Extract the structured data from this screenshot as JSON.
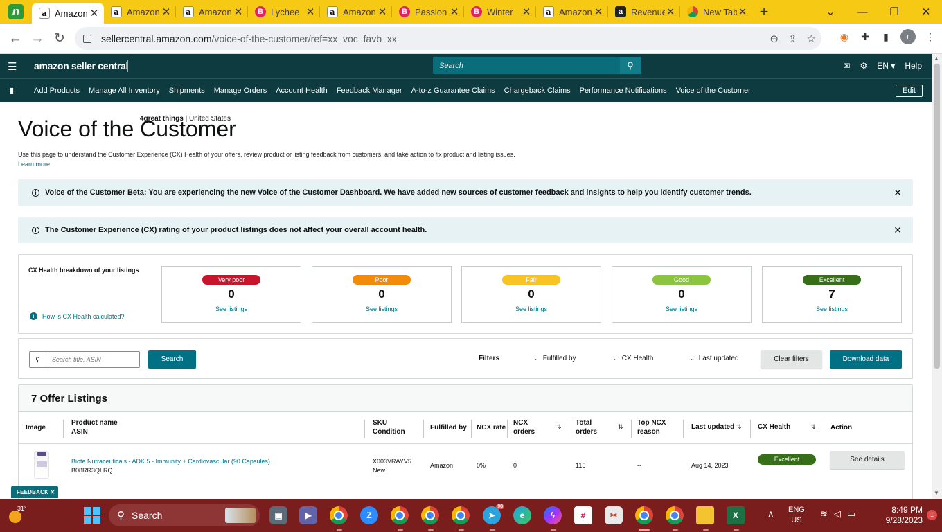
{
  "browser": {
    "tabs": [
      {
        "title": "Amazon",
        "favicon": "amazon-icon",
        "active": true
      },
      {
        "title": "Amazon",
        "favicon": "amazon-icon"
      },
      {
        "title": "Amazon",
        "favicon": "amazon-icon"
      },
      {
        "title": "Lychee",
        "favicon": "b-icon"
      },
      {
        "title": "Amazon",
        "favicon": "amazon-icon"
      },
      {
        "title": "Passion",
        "favicon": "b-icon"
      },
      {
        "title": "Winter",
        "favicon": "b-icon"
      },
      {
        "title": "Amazon",
        "favicon": "amazon-icon"
      },
      {
        "title": "Revenue",
        "favicon": "amazon-dark-icon"
      },
      {
        "title": "New Tab",
        "favicon": "chrome-icon"
      }
    ],
    "url_host": "sellercentral.amazon.com",
    "url_path": "/voice-of-the-customer/ref=xx_voc_favb_xx",
    "profile_initial": "r"
  },
  "header": {
    "brand": "amazon seller central",
    "store_name": "4great things",
    "store_region": "United States",
    "search_placeholder": "Search",
    "language": "EN",
    "help": "Help"
  },
  "nav": {
    "items": [
      "Add Products",
      "Manage All Inventory",
      "Shipments",
      "Manage Orders",
      "Account Health",
      "Feedback Manager",
      "A-to-z Guarantee Claims",
      "Chargeback Claims",
      "Performance Notifications",
      "Voice of the Customer"
    ],
    "edit": "Edit"
  },
  "page": {
    "title": "Voice of the Customer",
    "description": "Use this page to understand the Customer Experience (CX) Health of your offers, review product or listing feedback from customers, and take action to fix product and listing issues.",
    "learn_more": "Learn more",
    "alerts": [
      "Voice of the Customer Beta: You are experiencing the new Voice of the Customer Dashboard. We have added new sources of customer feedback and insights to help you identify customer trends.",
      "The Customer Experience (CX) rating of your product listings does not affect your overall account health."
    ]
  },
  "cx_health": {
    "label": "CX Health breakdown of your listings",
    "how_link": "How is CX Health calculated?",
    "cards": [
      {
        "label": "Very poor",
        "count": "0",
        "link": "See listings",
        "color": "#c7162b"
      },
      {
        "label": "Poor",
        "count": "0",
        "link": "See listings",
        "color": "#f28b0c"
      },
      {
        "label": "Fair",
        "count": "0",
        "link": "See listings",
        "color": "#f7c325"
      },
      {
        "label": "Good",
        "count": "0",
        "link": "See listings",
        "color": "#8bc53f"
      },
      {
        "label": "Excellent",
        "count": "7",
        "link": "See listings",
        "color": "#376f18"
      }
    ]
  },
  "filters": {
    "search_placeholder": "Search title, ASIN",
    "search_button": "Search",
    "label": "Filters",
    "fulfilled_by": "Fulfilled by",
    "cx_health": "CX Health",
    "last_updated": "Last updated",
    "clear": "Clear filters",
    "download": "Download data"
  },
  "listings": {
    "heading": "7 Offer Listings",
    "columns": {
      "image": "Image",
      "product_name": "Product name",
      "asin": "ASIN",
      "sku": "SKU",
      "condition": "Condition",
      "fulfilled_by": "Fulfilled by",
      "ncx_rate": "NCX rate",
      "ncx_orders_1": "NCX",
      "ncx_orders_2": "orders",
      "total_orders_1": "Total",
      "total_orders_2": "orders",
      "top_ncx_1": "Top NCX",
      "top_ncx_2": "reason",
      "last_updated": "Last updated",
      "cx_health": "CX Health",
      "action": "Action"
    },
    "rows": [
      {
        "product_name": "Biote Nutraceuticals - ADK 5 - Immunity + Cardiovascular (90 Capsules)",
        "asin": "B08RR3QLRQ",
        "sku": "X003VRAYV5",
        "condition": "New",
        "fulfilled_by": "Amazon",
        "ncx_rate": "0%",
        "ncx_orders": "0",
        "total_orders": "115",
        "top_ncx_reason": "--",
        "last_updated": "Aug 14, 2023",
        "cx_health": "Excellent",
        "action": "See details"
      }
    ]
  },
  "feedback_tab": "FEEDBACK",
  "taskbar": {
    "temperature": "31°",
    "search": "Search",
    "telegram_badge": "98",
    "lang_1": "ENG",
    "lang_2": "US",
    "time": "8:49 PM",
    "date": "9/28/2023",
    "notifications": "1"
  }
}
